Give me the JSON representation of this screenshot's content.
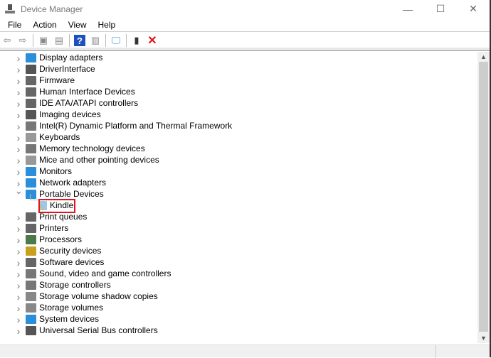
{
  "window": {
    "title": "Device Manager",
    "minimize": "—",
    "maximize": "☐",
    "close": "✕"
  },
  "menu": [
    "File",
    "Action",
    "View",
    "Help"
  ],
  "toolbar": [
    {
      "name": "back-icon",
      "glyph": "⇦"
    },
    {
      "name": "forward-icon",
      "glyph": "⇨"
    },
    {
      "name": "properties-icon",
      "glyph": "▣"
    },
    {
      "name": "console-tree-icon",
      "glyph": "▤"
    },
    {
      "name": "help-icon",
      "glyph": "?"
    },
    {
      "name": "action-pane-icon",
      "glyph": "▥"
    },
    {
      "name": "scan-hardware-icon",
      "glyph": "🖵"
    },
    {
      "name": "update-driver-icon",
      "glyph": "▮"
    },
    {
      "name": "uninstall-icon",
      "glyph": "✕"
    }
  ],
  "tree": [
    {
      "label": "Display adapters",
      "color": "#2a8fd8"
    },
    {
      "label": "DriverInterface",
      "color": "#555"
    },
    {
      "label": "Firmware",
      "color": "#666"
    },
    {
      "label": "Human Interface Devices",
      "color": "#666"
    },
    {
      "label": "IDE ATA/ATAPI controllers",
      "color": "#666"
    },
    {
      "label": "Imaging devices",
      "color": "#555"
    },
    {
      "label": "Intel(R) Dynamic Platform and Thermal Framework",
      "color": "#777"
    },
    {
      "label": "Keyboards",
      "color": "#999"
    },
    {
      "label": "Memory technology devices",
      "color": "#777"
    },
    {
      "label": "Mice and other pointing devices",
      "color": "#999"
    },
    {
      "label": "Monitors",
      "color": "#2a8fd8"
    },
    {
      "label": "Network adapters",
      "color": "#2a8fd8"
    },
    {
      "label": "Portable Devices",
      "color": "#2a8fd8",
      "expanded": true
    },
    {
      "label": "Kindle",
      "color": "#9cc8ea",
      "child": true,
      "warning": true
    },
    {
      "label": "Print queues",
      "color": "#666"
    },
    {
      "label": "Printers",
      "color": "#666"
    },
    {
      "label": "Processors",
      "color": "#4a7a4a"
    },
    {
      "label": "Security devices",
      "color": "#c8a020"
    },
    {
      "label": "Software devices",
      "color": "#666"
    },
    {
      "label": "Sound, video and game controllers",
      "color": "#777"
    },
    {
      "label": "Storage controllers",
      "color": "#777"
    },
    {
      "label": "Storage volume shadow copies",
      "color": "#888"
    },
    {
      "label": "Storage volumes",
      "color": "#888"
    },
    {
      "label": "System devices",
      "color": "#2a8fd8"
    },
    {
      "label": "Universal Serial Bus controllers",
      "color": "#555"
    }
  ],
  "colors": {
    "highlight": "#e0141e",
    "uninstall": "#e0141e",
    "help": "#2050c0"
  }
}
